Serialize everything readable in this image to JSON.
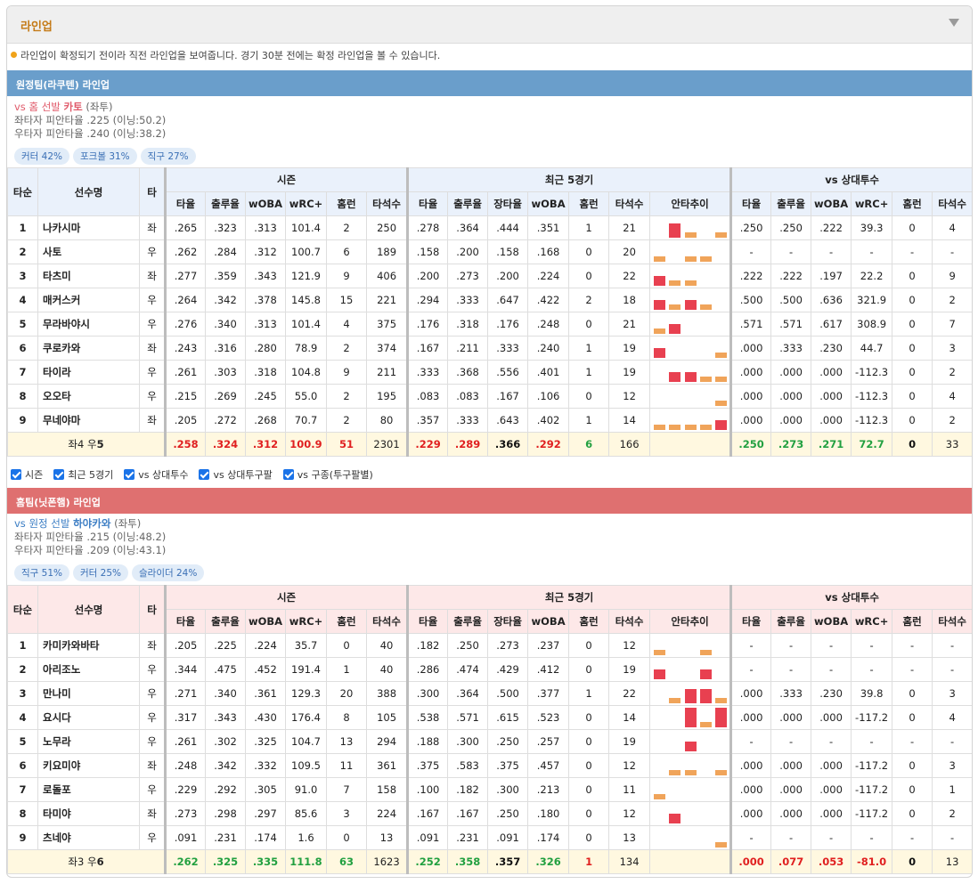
{
  "panel": {
    "title": "라인업",
    "notice": "라인업이 확정되기 전이라 직전 라인업을 보여줍니다. 경기 30분 전에는 확정 라인업을 볼 수 있습니다."
  },
  "colors": {
    "away_bar": "#6a9ecb",
    "home_bar": "#df7070",
    "bar_red": "#e84050",
    "bar_orange": "#f0a45a"
  },
  "headers": {
    "order": "타순",
    "name": "선수명",
    "hand": "타",
    "season": "시즌",
    "recent": "최근 5경기",
    "vs_pitcher": "vs 상대투수",
    "avg": "타율",
    "obp": "출루율",
    "slg": "장타율",
    "woba": "wOBA",
    "wrc": "wRC+",
    "hr": "홈런",
    "ab": "타석수",
    "trend": "안타추이"
  },
  "filters": [
    "시즌",
    "최근 5경기",
    "vs 상대투수",
    "vs 상대투구팔",
    "vs 구종(투구팔별)"
  ],
  "away": {
    "bar_title": "원정팀(라쿠텐) 라인업",
    "vs_label": "vs 홈 선발",
    "pitcher": "카토",
    "hand": "(좌투)",
    "line1": "좌타자 피안타율 .225 (이닝:50.2)",
    "line2": "우타자 피안타율 .240 (이닝:38.2)",
    "chips": [
      "커터 42%",
      "포크볼 31%",
      "직구 27%"
    ],
    "players": [
      {
        "no": "1",
        "name": "나카시마",
        "hand": "좌",
        "s": [
          ".265",
          ".323",
          ".313",
          "101.4",
          "2",
          "250"
        ],
        "r": [
          ".278",
          ".364",
          ".444",
          ".351",
          "1",
          "21"
        ],
        "trend": [
          0,
          3,
          1,
          0,
          1
        ],
        "v": [
          ".250",
          ".250",
          ".222",
          "39.3",
          "0",
          "4"
        ],
        "x": ".323"
      },
      {
        "no": "2",
        "name": "사토",
        "hand": "우",
        "s": [
          ".262",
          ".284",
          ".312",
          "100.7",
          "6",
          "189"
        ],
        "r": [
          ".158",
          ".200",
          ".158",
          ".168",
          "0",
          "20"
        ],
        "trend": [
          1,
          0,
          1,
          1,
          0
        ],
        "v": [
          "-",
          "-",
          "-",
          "-",
          "-",
          "-"
        ],
        "x": ".297"
      },
      {
        "no": "3",
        "name": "타츠미",
        "hand": "좌",
        "s": [
          ".277",
          ".359",
          ".343",
          "121.9",
          "9",
          "406"
        ],
        "r": [
          ".200",
          ".273",
          ".200",
          ".224",
          "0",
          "22"
        ],
        "trend": [
          2,
          1,
          1,
          0,
          0
        ],
        "v": [
          ".222",
          ".222",
          ".197",
          "22.2",
          "0",
          "9"
        ],
        "x": ".272"
      },
      {
        "no": "4",
        "name": "매커스커",
        "hand": "우",
        "s": [
          ".264",
          ".342",
          ".378",
          "145.8",
          "15",
          "221"
        ],
        "r": [
          ".294",
          ".333",
          ".647",
          ".422",
          "2",
          "18"
        ],
        "trend": [
          2,
          1,
          2,
          1,
          0
        ],
        "v": [
          ".500",
          ".500",
          ".636",
          "321.9",
          "0",
          "2"
        ],
        "x": ".279"
      },
      {
        "no": "5",
        "name": "무라바야시",
        "hand": "우",
        "s": [
          ".276",
          ".340",
          ".313",
          "101.4",
          "4",
          "375"
        ],
        "r": [
          ".176",
          ".318",
          ".176",
          ".248",
          "0",
          "21"
        ],
        "trend": [
          1,
          2,
          0,
          0,
          0
        ],
        "v": [
          ".571",
          ".571",
          ".617",
          "308.9",
          "0",
          "7"
        ],
        "x": ".286"
      },
      {
        "no": "6",
        "name": "쿠로카와",
        "hand": "좌",
        "s": [
          ".243",
          ".316",
          ".280",
          "78.9",
          "2",
          "374"
        ],
        "r": [
          ".167",
          ".211",
          ".333",
          ".240",
          "1",
          "19"
        ],
        "trend": [
          2,
          0,
          0,
          0,
          1
        ],
        "v": [
          ".000",
          ".333",
          ".230",
          "44.7",
          "0",
          "3"
        ],
        "x": ".240"
      },
      {
        "no": "7",
        "name": "타이라",
        "hand": "우",
        "s": [
          ".261",
          ".303",
          ".318",
          "104.8",
          "9",
          "211"
        ],
        "r": [
          ".333",
          ".368",
          ".556",
          ".401",
          "1",
          "19"
        ],
        "trend": [
          0,
          2,
          2,
          1,
          1
        ],
        "v": [
          ".000",
          ".000",
          ".000",
          "-112.3",
          "0",
          "2"
        ],
        "x": ".272"
      },
      {
        "no": "8",
        "name": "오오타",
        "hand": "우",
        "s": [
          ".215",
          ".269",
          ".245",
          "55.0",
          "2",
          "195"
        ],
        "r": [
          ".083",
          ".083",
          ".167",
          ".106",
          "0",
          "12"
        ],
        "trend": [
          0,
          0,
          0,
          0,
          1
        ],
        "v": [
          ".000",
          ".000",
          ".000",
          "-112.3",
          "0",
          "4"
        ],
        "x": ".266"
      },
      {
        "no": "9",
        "name": "무네야마",
        "hand": "좌",
        "s": [
          ".205",
          ".272",
          ".268",
          "70.7",
          "2",
          "80"
        ],
        "r": [
          ".357",
          ".333",
          ".643",
          ".402",
          "1",
          "14"
        ],
        "trend": [
          1,
          1,
          1,
          1,
          2
        ],
        "v": [
          ".000",
          ".000",
          ".000",
          "-112.3",
          "0",
          "2"
        ],
        "x": ".190"
      }
    ],
    "total": {
      "label_pre": "좌4 우",
      "label_num": "5",
      "s": [
        ".258",
        ".324",
        ".312",
        "100.9",
        "51",
        "2301"
      ],
      "r": [
        ".229",
        ".289",
        ".366",
        ".292",
        "6",
        "166"
      ],
      "v": [
        ".250",
        ".273",
        ".271",
        "72.7",
        "0",
        "33"
      ],
      "x": ".274"
    }
  },
  "home": {
    "bar_title": "홈팀(닛폰햄) 라인업",
    "vs_label": "vs 원정 선발",
    "pitcher": "하야카와",
    "hand": "(좌투)",
    "line1": "좌타자 피안타율 .215 (이닝:48.2)",
    "line2": "우타자 피안타율 .209 (이닝:43.1)",
    "chips": [
      "직구 51%",
      "커터 25%",
      "슬라이더 24%"
    ],
    "players": [
      {
        "no": "1",
        "name": "카미카와바타",
        "hand": "좌",
        "s": [
          ".205",
          ".225",
          ".224",
          "35.7",
          "0",
          "40"
        ],
        "r": [
          ".182",
          ".250",
          ".273",
          ".237",
          "0",
          "12"
        ],
        "trend": [
          1,
          0,
          0,
          1,
          0
        ],
        "v": [
          "-",
          "-",
          "-",
          "-",
          "-",
          "-"
        ],
        "x": ".286"
      },
      {
        "no": "2",
        "name": "아리조노",
        "hand": "우",
        "s": [
          ".344",
          ".475",
          ".452",
          "191.4",
          "1",
          "40"
        ],
        "r": [
          ".286",
          ".474",
          ".429",
          ".412",
          "0",
          "19"
        ],
        "trend": [
          2,
          0,
          0,
          2,
          0
        ],
        "v": [
          "-",
          "-",
          "-",
          "-",
          "-",
          "-"
        ],
        "x": ".600"
      },
      {
        "no": "3",
        "name": "만나미",
        "hand": "우",
        "s": [
          ".271",
          ".340",
          ".361",
          "129.3",
          "20",
          "388"
        ],
        "r": [
          ".300",
          ".364",
          ".500",
          ".377",
          "1",
          "22"
        ],
        "trend": [
          0,
          1,
          3,
          3,
          1
        ],
        "v": [
          ".000",
          ".333",
          ".230",
          "39.8",
          "0",
          "3"
        ],
        "x": ".258"
      },
      {
        "no": "4",
        "name": "요시다",
        "hand": "우",
        "s": [
          ".317",
          ".343",
          ".430",
          "176.4",
          "8",
          "105"
        ],
        "r": [
          ".538",
          ".571",
          ".615",
          ".523",
          "0",
          "14"
        ],
        "trend": [
          0,
          0,
          4,
          1,
          4
        ],
        "v": [
          ".000",
          ".000",
          ".000",
          "-117.2",
          "0",
          "4"
        ],
        "x": ".214"
      },
      {
        "no": "5",
        "name": "노무라",
        "hand": "우",
        "s": [
          ".261",
          ".302",
          ".325",
          "104.7",
          "13",
          "294"
        ],
        "r": [
          ".188",
          ".300",
          ".250",
          ".257",
          "0",
          "19"
        ],
        "trend": [
          0,
          0,
          2,
          0,
          0
        ],
        "v": [
          "-",
          "-",
          "-",
          "-",
          "-",
          "-"
        ],
        "x": ".325"
      },
      {
        "no": "6",
        "name": "키요미야",
        "hand": "좌",
        "s": [
          ".248",
          ".342",
          ".332",
          "109.5",
          "11",
          "361"
        ],
        "r": [
          ".375",
          ".583",
          ".375",
          ".457",
          "0",
          "12"
        ],
        "trend": [
          0,
          1,
          1,
          0,
          1
        ],
        "v": [
          ".000",
          ".000",
          ".000",
          "-117.2",
          "0",
          "3"
        ],
        "x": ".217"
      },
      {
        "no": "7",
        "name": "로돌포",
        "hand": "우",
        "s": [
          ".229",
          ".292",
          ".305",
          "91.0",
          "7",
          "158"
        ],
        "r": [
          ".100",
          ".182",
          ".300",
          ".213",
          "0",
          "11"
        ],
        "trend": [
          1,
          0,
          0,
          0,
          0
        ],
        "v": [
          ".000",
          ".000",
          ".000",
          "-117.2",
          "0",
          "1"
        ],
        "x": ".197"
      },
      {
        "no": "8",
        "name": "타미야",
        "hand": "좌",
        "s": [
          ".273",
          ".298",
          ".297",
          "85.6",
          "3",
          "224"
        ],
        "r": [
          ".167",
          ".167",
          ".250",
          ".180",
          "0",
          "12"
        ],
        "trend": [
          0,
          2,
          0,
          0,
          0
        ],
        "v": [
          ".000",
          ".000",
          ".000",
          "-117.2",
          "0",
          "2"
        ],
        "x": ".362"
      },
      {
        "no": "9",
        "name": "츠네야",
        "hand": "우",
        "s": [
          ".091",
          ".231",
          ".174",
          "1.6",
          "0",
          "13"
        ],
        "r": [
          ".091",
          ".231",
          ".091",
          ".174",
          "0",
          "13"
        ],
        "trend": [
          0,
          0,
          0,
          0,
          1
        ],
        "v": [
          "-",
          "-",
          "-",
          "-",
          "-",
          "-"
        ],
        "x": ".000"
      }
    ],
    "total": {
      "label_pre": "좌3 우",
      "label_num": "6",
      "s": [
        ".262",
        ".325",
        ".335",
        "111.8",
        "63",
        "1623"
      ],
      "r": [
        ".252",
        ".358",
        ".357",
        ".326",
        "1",
        "134"
      ],
      "v": [
        ".000",
        ".077",
        ".053",
        "-81.0",
        "0",
        "13"
      ],
      "x": ".268"
    }
  }
}
